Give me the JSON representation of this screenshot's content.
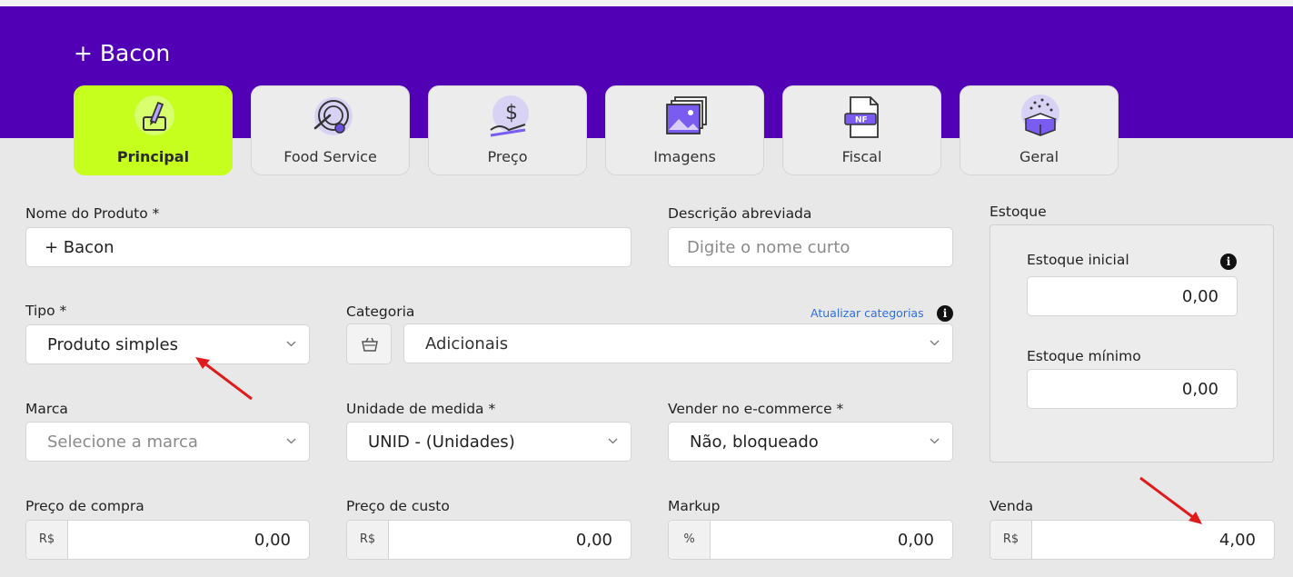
{
  "header": {
    "title": "+ Bacon"
  },
  "tabs": [
    {
      "label": "Principal",
      "icon": "edit-icon",
      "active": true
    },
    {
      "label": "Food Service",
      "icon": "plate-icon"
    },
    {
      "label": "Preço",
      "icon": "price-hand-icon"
    },
    {
      "label": "Imagens",
      "icon": "images-icon"
    },
    {
      "label": "Fiscal",
      "icon": "nf-document-icon"
    },
    {
      "label": "Geral",
      "icon": "gift-box-icon"
    }
  ],
  "form": {
    "nome": {
      "label": "Nome do Produto *",
      "value": "+ Bacon"
    },
    "descricao": {
      "label": "Descrição abreviada",
      "placeholder": "Digite o nome curto"
    },
    "tipo": {
      "label": "Tipo *",
      "value": "Produto simples"
    },
    "categoria": {
      "label": "Categoria",
      "value": "Adicionais",
      "update_link": "Atualizar categorias"
    },
    "marca": {
      "label": "Marca",
      "placeholder": "Selecione a marca"
    },
    "unidade": {
      "label": "Unidade de medida *",
      "value": "UNID - (Unidades)"
    },
    "ecommerce": {
      "label": "Vender no e-commerce *",
      "value": "Não, bloqueado"
    },
    "preco_compra": {
      "label": "Preço de compra",
      "prefix": "R$",
      "value": "0,00"
    },
    "preco_custo": {
      "label": "Preço de custo",
      "prefix": "R$",
      "value": "0,00"
    },
    "markup": {
      "label": "Markup",
      "prefix": "%",
      "value": "0,00"
    },
    "venda": {
      "label": "Venda",
      "prefix": "R$",
      "value": "4,00"
    }
  },
  "estoque": {
    "title": "Estoque",
    "inicial": {
      "label": "Estoque inicial",
      "value": "0,00"
    },
    "minimo": {
      "label": "Estoque mínimo",
      "value": "0,00"
    }
  },
  "info_glyph": "i",
  "colors": {
    "header": "#5200b5",
    "active_tab": "#c6ff1e",
    "link": "#2f6fdf",
    "annotation_arrow": "#e01b1b"
  }
}
